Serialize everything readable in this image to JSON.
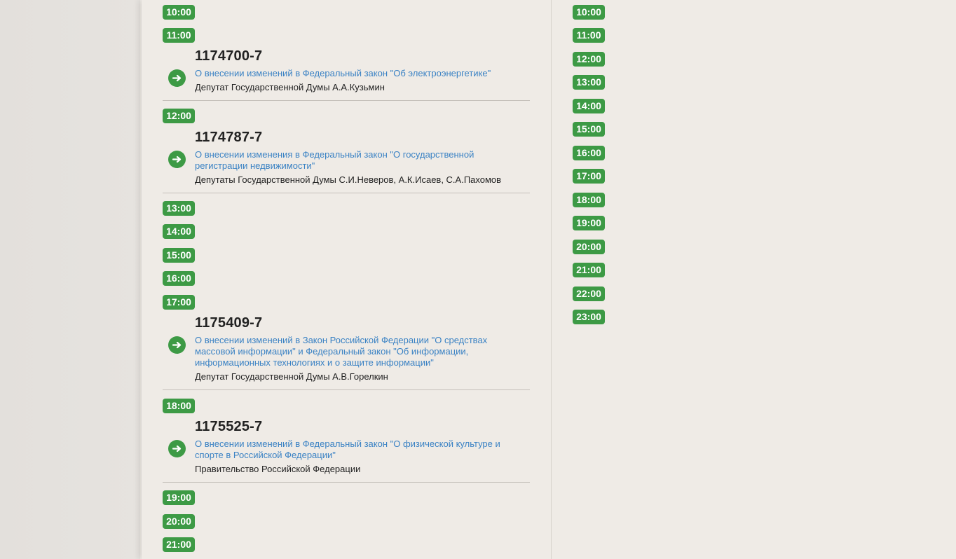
{
  "left_column": {
    "hours": [
      "10:00",
      "11:00",
      "12:00",
      "13:00",
      "14:00",
      "15:00",
      "16:00",
      "17:00",
      "18:00",
      "19:00",
      "20:00",
      "21:00"
    ],
    "bills": [
      {
        "number": "1174700-7",
        "title": "О внесении изменений в Федеральный закон \"Об электроэнергетике\"",
        "author": "Депутат Государственной Думы А.А.Кузьмин",
        "icon": "arrow-right-icon"
      },
      {
        "number": "1174787-7",
        "title": "О внесении изменения в Федеральный закон \"О государственной регистрации недвижимости\"",
        "author": "Депутаты Государственной Думы С.И.Неверов, А.К.Исаев, С.А.Пахомов",
        "icon": "arrow-right-icon"
      },
      {
        "number": "1175409-7",
        "title": "О внесении изменений в Закон Российской Федерации \"О средствах массовой информации\" и Федеральный закон \"Об информации, информационных технологиях и о защите информации\"",
        "author": "Депутат Государственной Думы А.В.Горелкин",
        "icon": "arrow-right-icon"
      },
      {
        "number": "1175525-7",
        "title": "О внесении изменений в Федеральный закон \"О физической культуре и спорте в Российской Федерации\"",
        "author": "Правительство Российской Федерации",
        "icon": "arrow-right-icon"
      }
    ]
  },
  "right_column": {
    "hours": [
      "10:00",
      "11:00",
      "12:00",
      "13:00",
      "14:00",
      "15:00",
      "16:00",
      "17:00",
      "18:00",
      "19:00",
      "20:00",
      "21:00",
      "22:00",
      "23:00"
    ]
  },
  "colors": {
    "badge": "#3d9a45",
    "link": "#3a82c4",
    "background": "#efebe6"
  }
}
